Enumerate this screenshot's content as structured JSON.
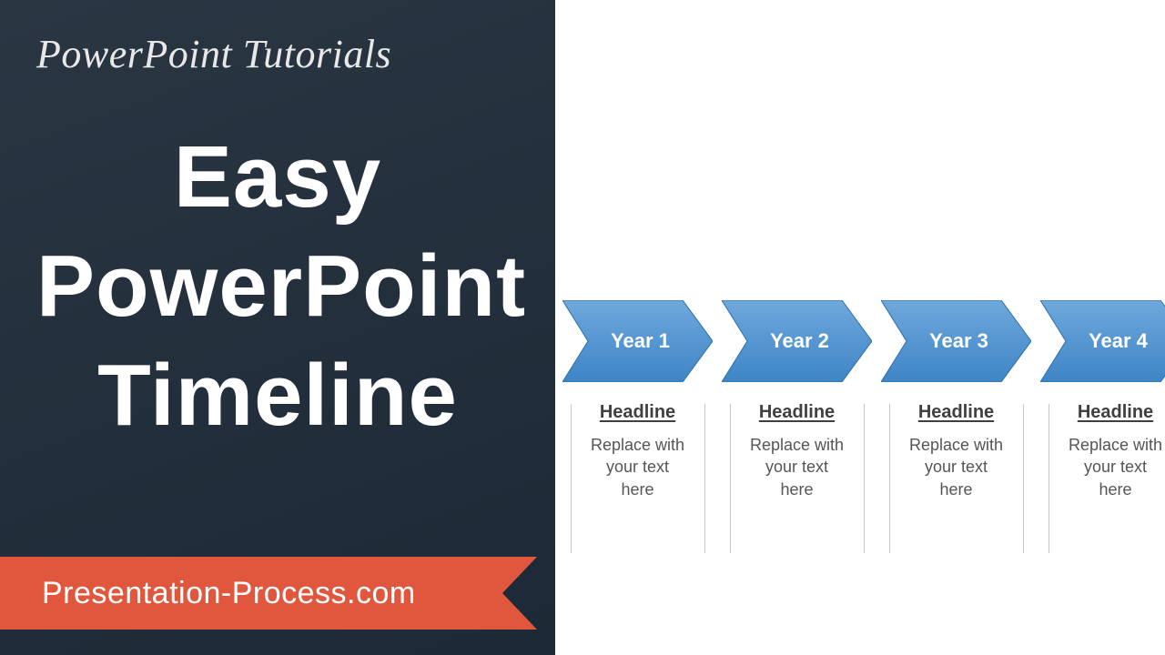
{
  "left": {
    "subtitle": "PowerPoint Tutorials",
    "title_line1": "Easy",
    "title_line2": "PowerPoint",
    "title_line3": "Timeline",
    "ribbon": "Presentation-Process.com"
  },
  "timeline": [
    {
      "label": "Year 1",
      "headline": "Headline",
      "body": "Replace with your text here"
    },
    {
      "label": "Year 2",
      "headline": "Headline",
      "body": "Replace with your text here"
    },
    {
      "label": "Year 3",
      "headline": "Headline",
      "body": "Replace with your text here"
    },
    {
      "label": "Year 4",
      "headline": "Headline",
      "body": "Replace with your text here"
    }
  ]
}
